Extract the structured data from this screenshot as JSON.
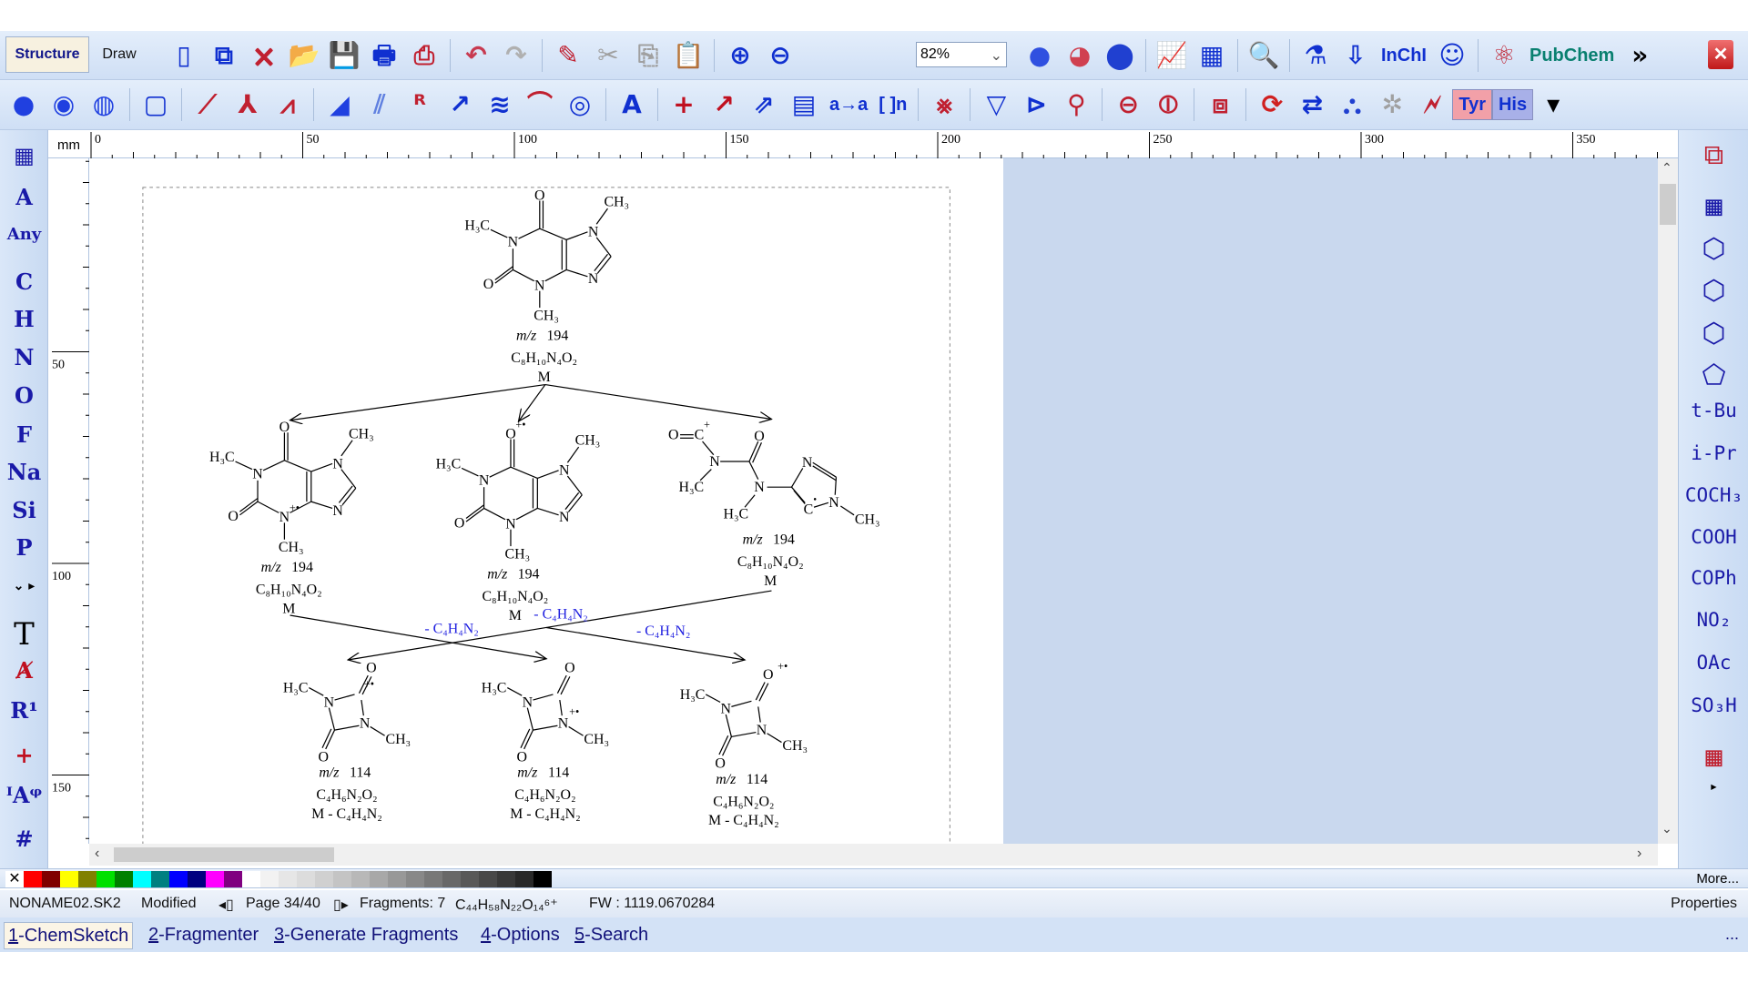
{
  "toolbar": {
    "structure_label": "Structure",
    "draw_label": "Draw",
    "zoom_value": "82%",
    "row1": [
      {
        "icon": "new-page-icon",
        "glyph": "▯",
        "color": "#1030d0"
      },
      {
        "icon": "copy-page-icon",
        "glyph": "⧉",
        "color": "#1030d0"
      },
      {
        "icon": "delete-page-icon",
        "glyph": "🗙",
        "color": "#c02030"
      },
      {
        "icon": "open-icon",
        "glyph": "📂",
        "color": "#c02030"
      },
      {
        "icon": "save-icon",
        "glyph": "💾",
        "color": "#1030d0"
      },
      {
        "icon": "print-icon",
        "glyph": "🖶",
        "color": "#1030d0"
      },
      {
        "icon": "pdf-icon",
        "glyph": "⎙",
        "color": "#c02030"
      },
      {
        "sep": true
      },
      {
        "icon": "undo-icon",
        "glyph": "↶",
        "color": "#c83a50"
      },
      {
        "icon": "redo-icon",
        "glyph": "↷",
        "color": "#b0b0b0"
      },
      {
        "sep": true
      },
      {
        "icon": "clean-icon",
        "glyph": "✎",
        "color": "#c02030"
      },
      {
        "icon": "cut-icon",
        "glyph": "✂",
        "color": "#a0a0a0"
      },
      {
        "icon": "copy-icon",
        "glyph": "⎘",
        "color": "#a0a0a0"
      },
      {
        "icon": "paste-icon",
        "glyph": "📋",
        "color": "#c02030"
      },
      {
        "sep": true
      },
      {
        "icon": "zoom-in-icon",
        "glyph": "⊕",
        "color": "#1030d0"
      },
      {
        "icon": "zoom-out-icon",
        "glyph": "⊖",
        "color": "#1030d0"
      }
    ],
    "row1b": [
      {
        "icon": "3d-atom-small-icon",
        "glyph": "●",
        "color": "#3050e0"
      },
      {
        "icon": "3d-atoms-icon",
        "glyph": "◕",
        "color": "#d04050"
      },
      {
        "icon": "3d-ball-icon",
        "glyph": "⬤",
        "color": "#2040d0"
      },
      {
        "sep": true
      },
      {
        "icon": "spectrum-icon",
        "glyph": "📈",
        "color": "#c02030"
      },
      {
        "icon": "table-icon",
        "glyph": "▦",
        "color": "#1030d0"
      },
      {
        "sep": true
      },
      {
        "icon": "search-structure-icon",
        "glyph": "🔍",
        "color": "#c02030"
      },
      {
        "sep": true
      },
      {
        "icon": "flask-icon",
        "glyph": "⚗",
        "color": "#1030d0"
      },
      {
        "icon": "download-icon",
        "glyph": "⇩",
        "color": "#1030d0"
      },
      {
        "icon": "inchi-icon",
        "label": "InChI",
        "color": "#1030d0"
      },
      {
        "icon": "smiley-icon",
        "glyph": "☺",
        "color": "#1030d0"
      },
      {
        "sep": true
      },
      {
        "icon": "molecule-3d-icon",
        "glyph": "⚛",
        "color": "#c02030"
      },
      {
        "icon": "pubchem-icon",
        "label": "PubChem",
        "color": "#0a8070"
      },
      {
        "icon": "more-chevron-icon",
        "glyph": "»",
        "color": "#000"
      }
    ],
    "row2": [
      {
        "icon": "select-atom-icon",
        "glyph": "●",
        "color": "#2040e0"
      },
      {
        "icon": "rotate-icon",
        "glyph": "◉",
        "color": "#2040e0"
      },
      {
        "icon": "3d-rotate-icon",
        "glyph": "◍",
        "color": "#2040e0"
      },
      {
        "sep": true
      },
      {
        "icon": "select-rect-icon",
        "glyph": "▢",
        "color": "#1030d0"
      },
      {
        "sep": true
      },
      {
        "icon": "draw-bond-icon",
        "glyph": "⟋",
        "color": "#c02030"
      },
      {
        "icon": "draw-branch-icon",
        "glyph": "⅄",
        "color": "#c02030"
      },
      {
        "icon": "draw-chain-icon",
        "glyph": "⩘",
        "color": "#c02030"
      },
      {
        "sep": true
      },
      {
        "icon": "wedge-bond-icon",
        "glyph": "◢",
        "color": "#2040e0"
      },
      {
        "icon": "hash-bond-icon",
        "glyph": "⫽",
        "color": "#6080e0"
      },
      {
        "icon": "r-group-icon",
        "glyph": "ᴿ",
        "color": "#c02030"
      },
      {
        "icon": "arrow-bond-icon",
        "glyph": "↗",
        "color": "#1030d0"
      },
      {
        "icon": "wavy-bond-icon",
        "glyph": "≋",
        "color": "#1030d0"
      },
      {
        "icon": "attach-point-icon",
        "glyph": "⌒",
        "color": "#c02030"
      },
      {
        "icon": "ring-icon",
        "glyph": "◎",
        "color": "#1030d0"
      },
      {
        "sep": true
      },
      {
        "icon": "atom-number-icon",
        "glyph": "A",
        "color": "#1030d0"
      },
      {
        "sep": true
      },
      {
        "icon": "plus-icon",
        "glyph": "+",
        "color": "#c01020"
      },
      {
        "icon": "reaction-arrow-icon",
        "glyph": "↗",
        "color": "#c01020"
      },
      {
        "icon": "charge-arrow-icon",
        "glyph": "⇗",
        "color": "#1030d0"
      },
      {
        "icon": "reaction-table-icon",
        "glyph": "▤",
        "color": "#1030d0"
      },
      {
        "icon": "atom-mapping-icon",
        "label": "a→a",
        "color": "#1030d0"
      },
      {
        "icon": "polymer-bracket-icon",
        "label": "[ ]n",
        "color": "#1030d0"
      },
      {
        "sep": true
      },
      {
        "icon": "delete-bond-icon",
        "glyph": "⨳",
        "color": "#c02030"
      },
      {
        "sep": true
      },
      {
        "icon": "flip-vertical-icon",
        "glyph": "▽",
        "color": "#1030d0"
      },
      {
        "icon": "flip-horizontal-icon",
        "glyph": "⊳",
        "color": "#1030d0"
      },
      {
        "icon": "rotate-bond-icon",
        "glyph": "⚲",
        "color": "#c02030"
      },
      {
        "sep": true
      },
      {
        "icon": "rotate-3d-x-icon",
        "glyph": "⊖",
        "color": "#c02030"
      },
      {
        "icon": "rotate-3d-y-icon",
        "glyph": "⦶",
        "color": "#c02030"
      },
      {
        "sep": true
      },
      {
        "icon": "3d-optimize-icon",
        "glyph": "⧈",
        "color": "#c02030"
      },
      {
        "sep": true
      },
      {
        "icon": "refresh-icon",
        "glyph": "⟳",
        "color": "#d02020"
      },
      {
        "icon": "tautomer-icon",
        "glyph": "⇄",
        "color": "#1030d0"
      },
      {
        "icon": "group-icon",
        "glyph": "⛬",
        "color": "#2040d0"
      },
      {
        "icon": "ungroup-icon",
        "glyph": "✲",
        "color": "#a0a0a0"
      },
      {
        "icon": "calc-table-icon",
        "glyph": "🗲",
        "color": "#c02030"
      },
      {
        "icon": "tyr-button",
        "label": "Tyr",
        "color": "#1030d0",
        "bg": "#f2a0a8"
      },
      {
        "icon": "his-button",
        "label": "His",
        "color": "#1030d0",
        "bg": "#a8b0e8"
      },
      {
        "icon": "overflow-icon",
        "glyph": "▾",
        "color": "#000"
      }
    ]
  },
  "left_toolbar": [
    {
      "icon": "periodic-table-icon",
      "glyph": "▦"
    },
    {
      "icon": "element-a",
      "label": "A"
    },
    {
      "icon": "element-any",
      "label": "Any"
    },
    {
      "icon": "element-c",
      "label": "C"
    },
    {
      "icon": "element-h",
      "label": "H"
    },
    {
      "icon": "element-n",
      "label": "N"
    },
    {
      "icon": "element-o",
      "label": "O"
    },
    {
      "icon": "element-f",
      "label": "F"
    },
    {
      "icon": "element-na",
      "label": "Na"
    },
    {
      "icon": "element-si",
      "label": "Si"
    },
    {
      "icon": "element-p",
      "label": "P"
    },
    {
      "icon": "expand-chevron-icon",
      "glyph": "⌄ ▸"
    },
    {
      "icon": "text-icon",
      "label": "T"
    },
    {
      "icon": "atom-label-icon",
      "glyph": "Ⱥ"
    },
    {
      "icon": "r-substituent-icon",
      "label": "R¹"
    },
    {
      "icon": "charge-plus-icon",
      "glyph": "+"
    },
    {
      "icon": "isotope-label-icon",
      "label": "ᴵAᵠ"
    },
    {
      "icon": "numbering-icon",
      "glyph": "#"
    }
  ],
  "right_toolbar": [
    {
      "icon": "templates-icon",
      "glyph": "⧉"
    },
    {
      "icon": "cf3-template-icon",
      "glyph": "▦"
    },
    {
      "icon": "benzene-icon",
      "glyph": "⬡"
    },
    {
      "icon": "cyclohexadiene-icon",
      "glyph": "⬡"
    },
    {
      "icon": "cyclohexane-icon",
      "glyph": "⬡"
    },
    {
      "icon": "cyclopentane-icon",
      "glyph": "⬠"
    },
    {
      "icon": "tbu-group",
      "label": "t-Bu"
    },
    {
      "icon": "ipr-group",
      "label": "i-Pr"
    },
    {
      "icon": "coch3-group",
      "label": "COCH₃"
    },
    {
      "icon": "cooh-group",
      "label": "COOH"
    },
    {
      "icon": "coph-group",
      "label": "COPh"
    },
    {
      "icon": "no2-group",
      "label": "NO₂"
    },
    {
      "icon": "oac-group",
      "label": "OAc"
    },
    {
      "icon": "so3h-group",
      "label": "SO₃H"
    },
    {
      "icon": "user-templates-icon",
      "glyph": "▦"
    },
    {
      "icon": "expand-right-icon",
      "glyph": "▸"
    }
  ],
  "ruler": {
    "unit": "mm",
    "h_labels": [
      "0",
      "50",
      "100",
      "150",
      "200",
      "250",
      "300",
      "350"
    ],
    "v_labels": [
      "50",
      "100",
      "150"
    ]
  },
  "palette": [
    "none",
    "#ff0000",
    "#800000",
    "#ffff00",
    "#808000",
    "#00e000",
    "#008000",
    "#00ffff",
    "#008080",
    "#0000ff",
    "#000080",
    "#ff00ff",
    "#800080",
    "#ffffff",
    "#f2f2f2",
    "#e6e6e6",
    "#dcdcdc",
    "#d0d0d0",
    "#c4c4c4",
    "#b8b8b8",
    "#a8a8a8",
    "#989898",
    "#888888",
    "#787878",
    "#686868",
    "#585858",
    "#484848",
    "#383838",
    "#282828",
    "#000000"
  ],
  "palette_more": "More...",
  "status": {
    "filename": "NONAME02.SK2",
    "state": "Modified",
    "page": "Page 34/40",
    "fragments": "Fragments: 7",
    "formula": "C₄₄H₅₈N₂₂O₁₄⁶⁺",
    "fw": "FW : 1119.0670284",
    "properties": "Properties"
  },
  "tabs": [
    {
      "key": "1",
      "label": "-ChemSketch",
      "active": true
    },
    {
      "key": "2",
      "label": "-Fragmenter"
    },
    {
      "key": "3",
      "label": "-Generate Fragments"
    },
    {
      "key": "4",
      "label": "-Options"
    },
    {
      "key": "5",
      "label": "-Search"
    }
  ],
  "tabs_more": "...",
  "scheme": {
    "mz": "m/z",
    "loss": "- C₄H₄N₂",
    "parent": {
      "mz": "194",
      "formula": "C₈H₁₀N₄O₂",
      "label": "M"
    },
    "level1": [
      {
        "mz": "194",
        "formula": "C₈H₁₀N₄O₂",
        "label": "M",
        "charge": "+•"
      },
      {
        "mz": "194",
        "formula": "C₈H₁₀N₄O₂",
        "label": "M",
        "charge": "+•"
      },
      {
        "mz": "194",
        "formula": "C₈H₁₀N₄O₂",
        "label": "M",
        "charge": "+"
      }
    ],
    "level2": [
      {
        "mz": "114",
        "formula": "C₄H₆N₂O₂",
        "label": "M - C₄H₄N₂",
        "charge": "+•"
      },
      {
        "mz": "114",
        "formula": "C₄H₆N₂O₂",
        "label": "M - C₄H₄N₂",
        "charge": "+•"
      },
      {
        "mz": "114",
        "formula": "C₄H₆N₂O₂",
        "label": "M - C₄H₄N₂",
        "charge": "+•"
      }
    ],
    "atoms": {
      "O": "O",
      "N": "N",
      "C": "C",
      "CH3": "CH₃",
      "H3C": "H₃C",
      "dot": "•"
    }
  },
  "colors": {
    "accent": "#1a1aa8",
    "loss_text": "#2020e0",
    "workspace": "#c9d8ee"
  }
}
